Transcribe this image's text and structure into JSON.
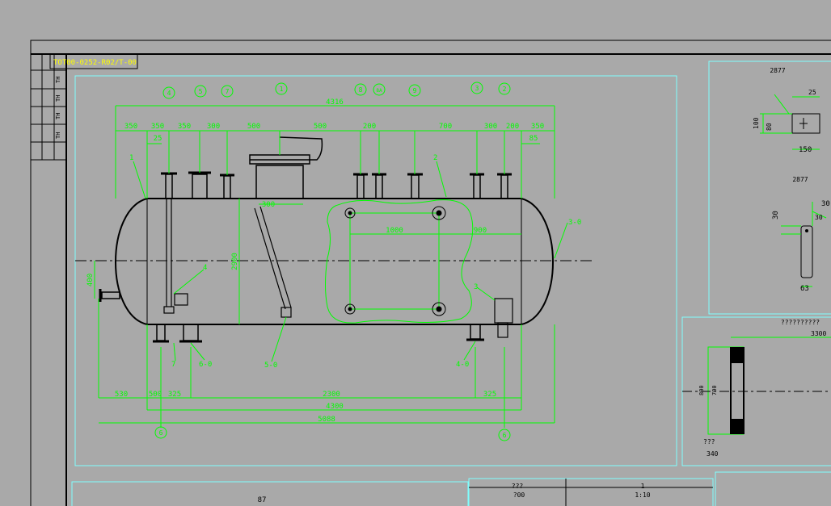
{
  "colors": {
    "background": "#a9a9a9",
    "frame": "#000000",
    "viewport": "#7fffff",
    "geometry": "#000000",
    "dimension": "#00ff00",
    "highlight": "#ffff00"
  },
  "title_tab": "TOT00-0252-R02/T-00",
  "side_block_labels": [
    "TH",
    "TH",
    "TH",
    "TH"
  ],
  "main_view": {
    "dim_overall_top": "4316",
    "dims_top_row": [
      "350",
      "350",
      "350",
      "300",
      "500",
      "500",
      "200",
      "700",
      "300",
      "200",
      "350"
    ],
    "dim_small_marks": [
      "25",
      "85"
    ],
    "dim_nozzle_offset": "300",
    "dim_manway_span": "1000",
    "dim_manway_right": "900",
    "dim_vertical_left": "400",
    "dim_vertical_center": "2900",
    "dims_bottom_row": [
      "530",
      "500",
      "325",
      "2300",
      "325"
    ],
    "dim_total_lower": "4300",
    "dim_total_bottom": "5088",
    "nozzle_balloons": [
      "4",
      "5",
      "7",
      "1",
      "8",
      "8A",
      "9",
      "3",
      "2"
    ],
    "section_balloons": [
      "6",
      "6"
    ],
    "callouts": [
      "1",
      "2",
      "3",
      "3-0",
      "4",
      "5-0",
      "6-0",
      "7",
      "4-0"
    ]
  },
  "detail_views": {
    "upper_title": "2877",
    "upper_dims": [
      "25",
      "100",
      "80",
      "150"
    ],
    "mid_title": "2877",
    "mid_dims": [
      "30",
      "30",
      "30",
      "63"
    ],
    "lower_title": "??????????",
    "lower_dims": [
      "3300",
      "800",
      "700",
      "???",
      "340"
    ]
  },
  "title_block": {
    "left_label": "87",
    "mid_label": "???",
    "mid_value": "?00",
    "scale_label": "1",
    "scale_value": "1:10"
  }
}
